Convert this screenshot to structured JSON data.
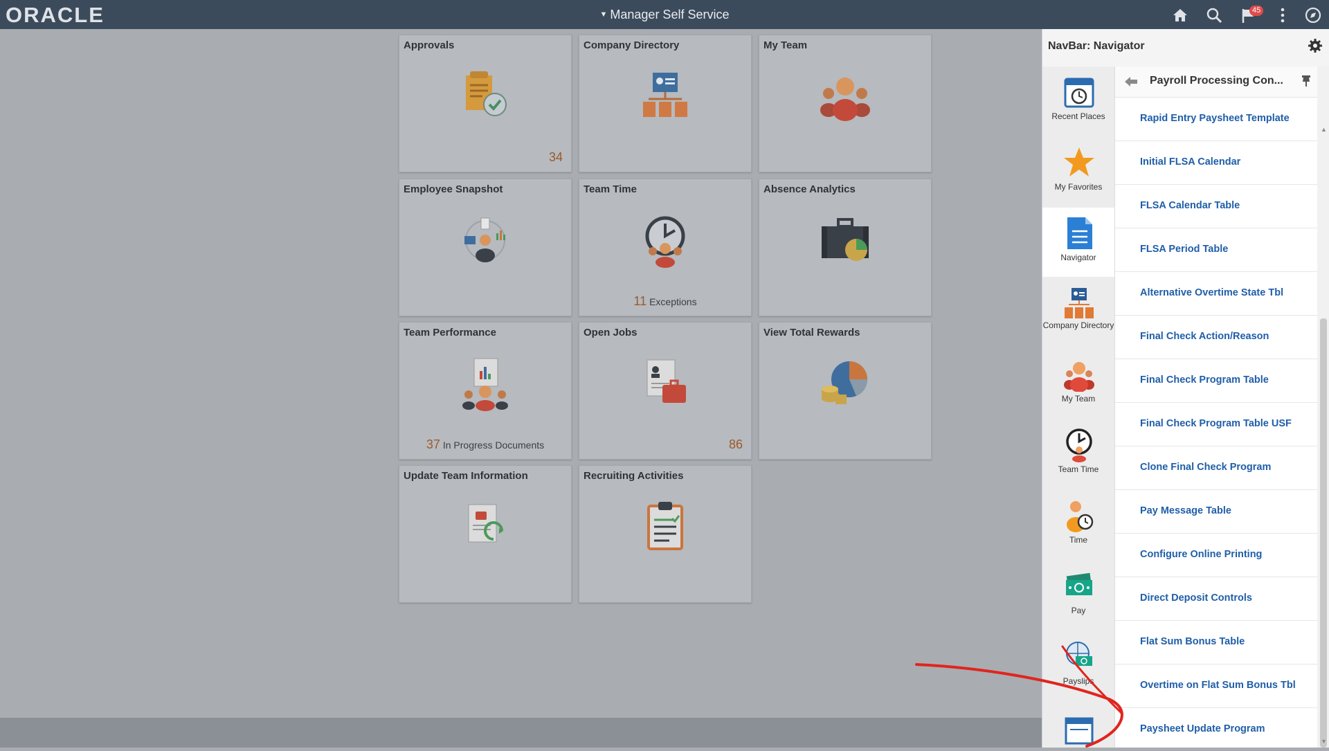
{
  "header": {
    "logo": "ORACLE",
    "title": "Manager Self Service",
    "notification_count": "45"
  },
  "tiles": [
    {
      "title": "Approvals",
      "count": "34",
      "icon": "approvals-icon"
    },
    {
      "title": "Company Directory",
      "icon": "company-directory-icon"
    },
    {
      "title": "My Team",
      "icon": "my-team-icon"
    },
    {
      "title": "Employee Snapshot",
      "icon": "employee-snapshot-icon"
    },
    {
      "title": "Team Time",
      "foot_num": "11",
      "foot_text": "Exceptions",
      "icon": "team-time-icon"
    },
    {
      "title": "Absence Analytics",
      "icon": "briefcase-icon"
    },
    {
      "title": "Team Performance",
      "foot_num": "37",
      "foot_text": "In Progress Documents",
      "icon": "team-performance-icon"
    },
    {
      "title": "Open Jobs",
      "count": "86",
      "icon": "open-jobs-icon"
    },
    {
      "title": "View Total Rewards",
      "icon": "total-rewards-icon"
    },
    {
      "title": "Update Team Information",
      "icon": "update-team-icon"
    },
    {
      "title": "Recruiting Activities",
      "icon": "clipboard-icon"
    }
  ],
  "navbar": {
    "title": "NavBar: Navigator",
    "left_items": [
      {
        "label": "Recent Places",
        "icon": "recent-places-icon"
      },
      {
        "label": "My Favorites",
        "icon": "star-icon"
      },
      {
        "label": "Navigator",
        "icon": "navigator-icon"
      },
      {
        "label": "Company Directory",
        "icon": "company-directory-icon"
      },
      {
        "label": "My Team",
        "icon": "my-team-icon"
      },
      {
        "label": "Team Time",
        "icon": "team-time-icon"
      },
      {
        "label": "Time",
        "icon": "time-icon"
      },
      {
        "label": "Pay",
        "icon": "pay-icon"
      },
      {
        "label": "Payslips",
        "icon": "payslips-icon"
      }
    ],
    "folder_title": "Payroll Processing Con...",
    "links": [
      "Rapid Entry Paysheet Template",
      "Initial FLSA Calendar",
      "FLSA Calendar Table",
      "FLSA Period Table",
      "Alternative Overtime State Tbl",
      "Final Check Action/Reason",
      "Final Check Program Table",
      "Final Check Program Table USF",
      "Clone Final Check Program",
      "Pay Message Table",
      "Configure Online Printing",
      "Direct Deposit Controls",
      "Flat Sum Bonus Table",
      "Overtime on Flat Sum Bonus Tbl",
      "Paysheet Update Program"
    ]
  },
  "colors": {
    "header": "#3c4b5c",
    "link": "#1f5ea8",
    "annotation": "#e0251e"
  }
}
